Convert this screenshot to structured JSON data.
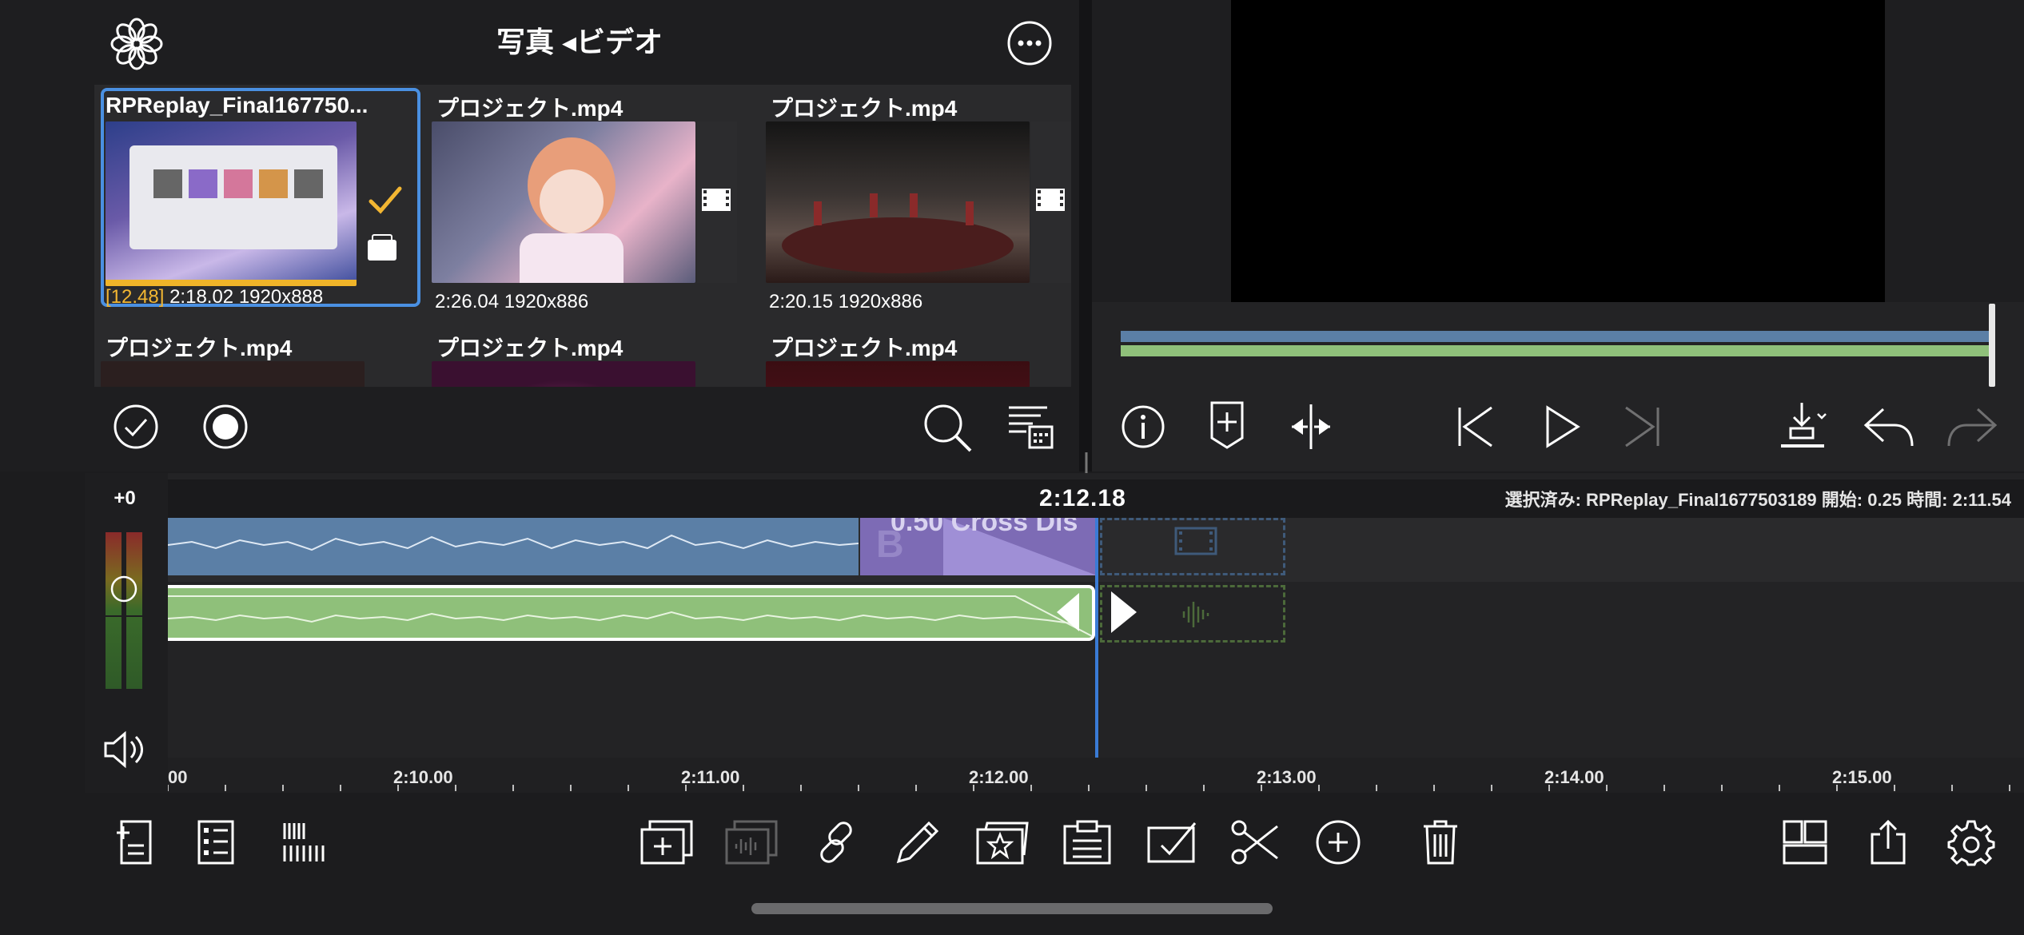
{
  "library": {
    "title": "写真 ◂ビデオ",
    "items": [
      {
        "title": "RPReplay_Final167750...",
        "meta_prefix": "[12.48]",
        "meta": "2:18.02  1920x888",
        "selected": true
      },
      {
        "title": "プロジェクト.mp4",
        "meta": "2:26.04  1920x886"
      },
      {
        "title": "プロジェクト.mp4",
        "meta": "2:20.15  1920x886"
      },
      {
        "title": "プロジェクト.mp4"
      },
      {
        "title": "プロジェクト.mp4"
      },
      {
        "title": "プロジェクト.mp4"
      }
    ],
    "bottom_icons": [
      "check-circle-icon",
      "record-icon",
      "search-icon",
      "sort-date-icon"
    ]
  },
  "preview": {
    "transport_icons": [
      "info-icon",
      "add-marker-icon",
      "split-icon",
      "skip-back-icon",
      "play-icon",
      "skip-forward-icon",
      "export-frame-icon",
      "undo-icon",
      "redo-icon"
    ]
  },
  "timeline": {
    "gain_label": "+0",
    "timecode": "2:12.18",
    "selection_info": "選択済み: RPReplay_Final1677503189 開始: 0.25 時間: 2:11.54",
    "transition_label": "0.50   Cross Dis",
    "ruler": [
      "00",
      "2:10.00",
      "2:11.00",
      "2:12.00",
      "2:13.00",
      "2:14.00",
      "2:15.00"
    ],
    "colors": {
      "video": "#5b7fa6",
      "audio": "#8fc07a",
      "playhead": "#3a7bd5",
      "transition": "#7d6bb5"
    }
  },
  "toolbar": {
    "icons": [
      "add-clip-icon",
      "list-icon",
      "barcode-icon",
      "add-overlay-icon",
      "audio-overlay-icon",
      "link-icon",
      "pencil-icon",
      "favorite-icon",
      "clipboard-icon",
      "check-box-icon",
      "scissors-icon",
      "add-circle-icon",
      "trash-icon",
      "layout-icon",
      "share-icon",
      "settings-icon"
    ]
  }
}
